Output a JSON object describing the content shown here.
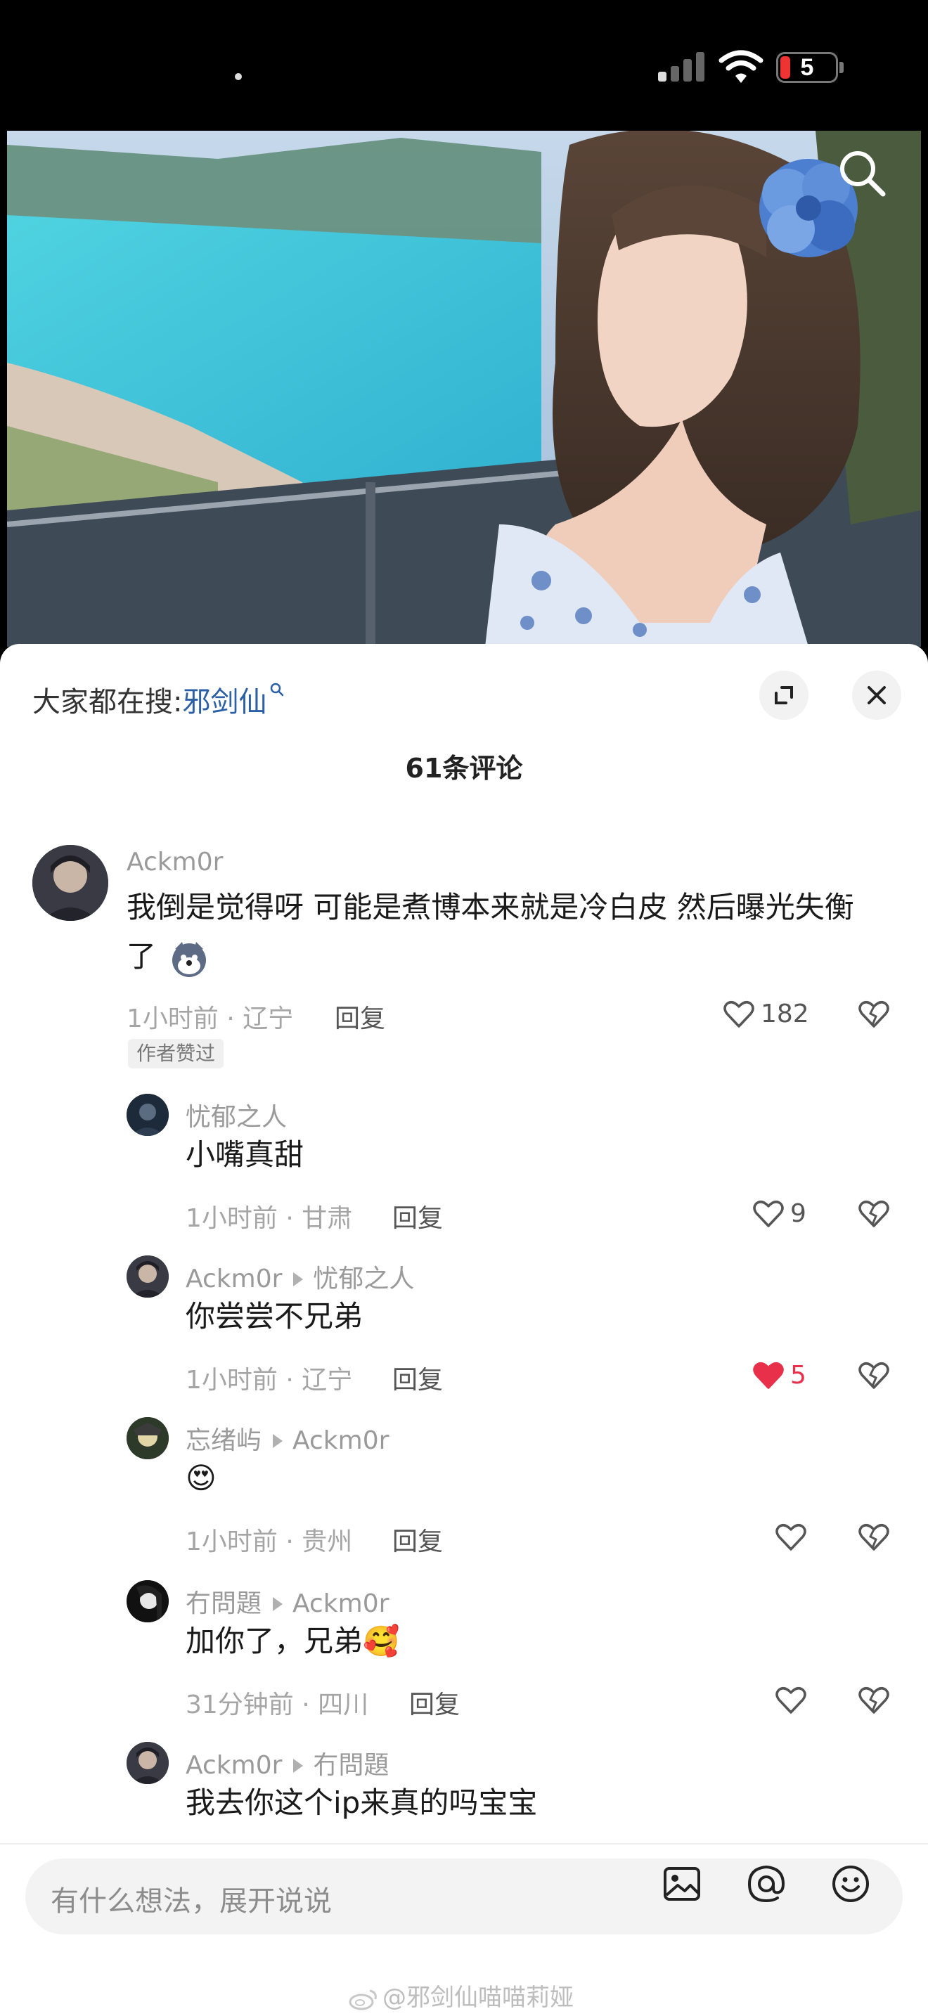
{
  "status_bar": {
    "battery": "5"
  },
  "header": {
    "trend_prefix": "大家都在搜:",
    "trend_keyword": "邪剑仙",
    "comment_count_title": "61条评论"
  },
  "comments": [
    {
      "user": "Ackm0r",
      "text_line1": "我倒是觉得呀 可能是煮博本来就是冷白皮 然后曝光失衡",
      "text_line2": "了",
      "meta": "1小时前 · 辽宁",
      "reply": "回复",
      "likes": "182",
      "badge": "作者赞过"
    },
    {
      "user": "忧郁之人",
      "text": "小嘴真甜",
      "meta": "1小时前 · 甘肃",
      "reply": "回复",
      "likes": "9"
    },
    {
      "user": "Ackm0r",
      "reply_to": "忧郁之人",
      "text": "你尝尝不兄弟",
      "meta": "1小时前 · 辽宁",
      "reply": "回复",
      "likes": "5",
      "liked": true
    },
    {
      "user": "忘绪屿",
      "reply_to": "Ackm0r",
      "text": "😍",
      "meta": "1小时前 · 贵州",
      "reply": "回复"
    },
    {
      "user": "冇問題",
      "reply_to": "Ackm0r",
      "text": "加你了，兄弟",
      "text_emoji": "🥰",
      "meta": "31分钟前 · 四川",
      "reply": "回复"
    },
    {
      "user": "Ackm0r",
      "reply_to": "冇問題",
      "text": "我去你这个ip来真的吗宝宝"
    }
  ],
  "input": {
    "placeholder": "有什么想法，展开说说"
  },
  "watermark": "@邪剑仙喵喵莉娅",
  "colors": {
    "link": "#2b5fa6",
    "like_red": "#e8304a"
  }
}
